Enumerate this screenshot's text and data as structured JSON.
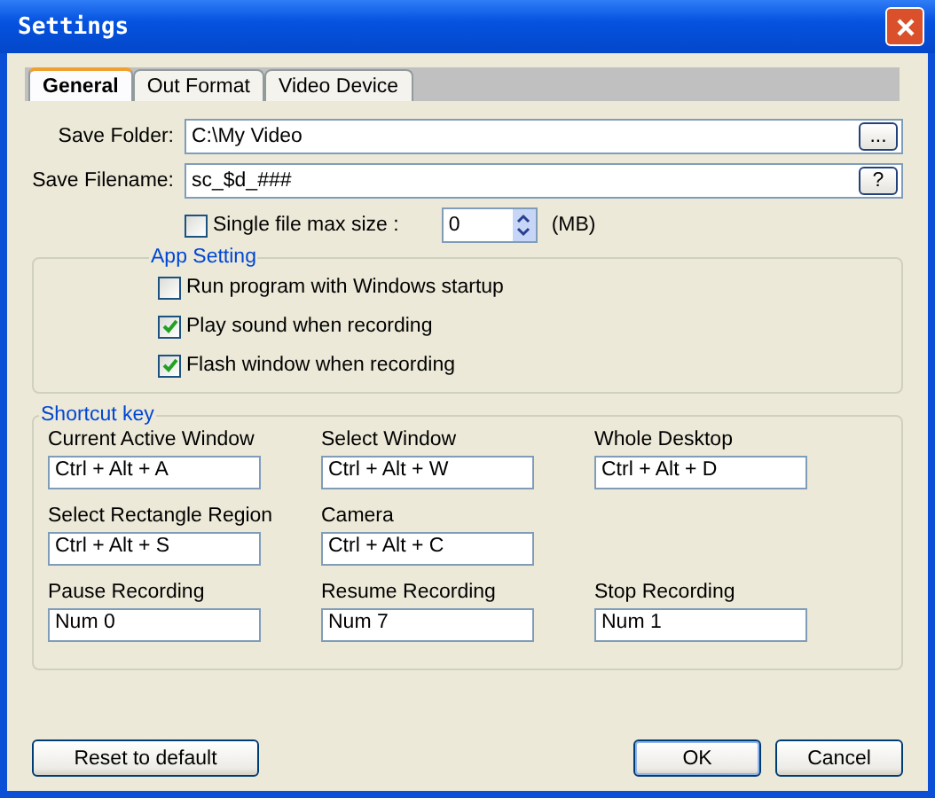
{
  "window": {
    "title": "Settings"
  },
  "tabs": [
    {
      "label": "General",
      "selected": true
    },
    {
      "label": "Out Format",
      "selected": false
    },
    {
      "label": "Video Device",
      "selected": false
    }
  ],
  "save_folder": {
    "label": "Save Folder:",
    "value": "C:\\My Video",
    "button": "..."
  },
  "save_filename": {
    "label": "Save Filename:",
    "value": "sc_$d_###",
    "button": "?"
  },
  "max_size": {
    "label": "Single file max size :",
    "checked": false,
    "value": "0",
    "unit": "(MB)"
  },
  "app_setting": {
    "title": "App Setting",
    "options": [
      {
        "label": "Run program with Windows startup",
        "checked": false
      },
      {
        "label": "Play sound when recording",
        "checked": true
      },
      {
        "label": "Flash window when recording",
        "checked": true
      }
    ]
  },
  "shortcut_key": {
    "title": "Shortcut key",
    "rows": [
      [
        {
          "label": "Current Active Window",
          "value": "Ctrl + Alt + A"
        },
        {
          "label": "Select Window",
          "value": "Ctrl + Alt + W"
        },
        {
          "label": "Whole Desktop",
          "value": "Ctrl + Alt + D"
        }
      ],
      [
        {
          "label": "Select Rectangle Region",
          "value": "Ctrl + Alt + S"
        },
        {
          "label": "Camera",
          "value": "Ctrl + Alt + C"
        }
      ],
      [
        {
          "label": "Pause Recording",
          "value": "Num 0"
        },
        {
          "label": "Resume Recording",
          "value": "Num 7"
        },
        {
          "label": "Stop Recording",
          "value": "Num 1"
        }
      ]
    ]
  },
  "buttons": {
    "reset": "Reset to default",
    "ok": "OK",
    "cancel": "Cancel"
  }
}
